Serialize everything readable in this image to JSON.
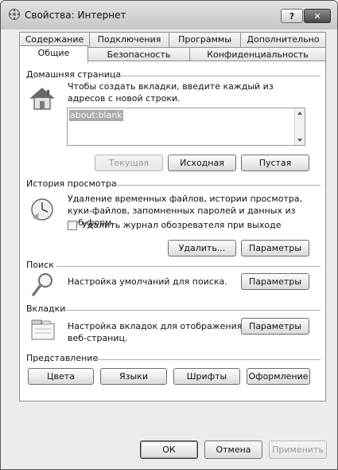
{
  "window": {
    "title": "Свойства: Интернет",
    "help_label": "?",
    "close_label": "✕"
  },
  "tabs": {
    "row1": [
      "Содержание",
      "Подключения",
      "Программы",
      "Дополнительно"
    ],
    "row2": [
      "Общие",
      "Безопасность",
      "Конфиденциальность"
    ],
    "active": "Общие"
  },
  "home_page": {
    "title": "Домашняя страница",
    "description": "Чтобы создать вкладки, введите каждый из адресов с новой строки.",
    "value": "about:blank",
    "buttons": {
      "current": "Текущая",
      "default": "Исходная",
      "blank": "Пустая"
    }
  },
  "history": {
    "title": "История просмотра",
    "description": "Удаление временных файлов, истории просмотра, куки-файлов, запомненных паролей и данных из веб-форм.",
    "checkbox_label": "Удалить журнал обозревателя при выходе",
    "checkbox_checked": false,
    "buttons": {
      "delete": "Удалить...",
      "settings": "Параметры"
    }
  },
  "search": {
    "title": "Поиск",
    "description": "Настройка умолчаний для поиска.",
    "settings_label": "Параметры"
  },
  "tabs_section": {
    "title": "Вкладки",
    "description": "Настройка вкладок для отображения веб-страниц.",
    "settings_label": "Параметры"
  },
  "appearance": {
    "title": "Представление",
    "buttons": {
      "colors": "Цвета",
      "languages": "Языки",
      "fonts": "Шрифты",
      "accessibility": "Оформление"
    }
  },
  "dialog_buttons": {
    "ok": "ОК",
    "cancel": "Отмена",
    "apply": "Применить"
  }
}
